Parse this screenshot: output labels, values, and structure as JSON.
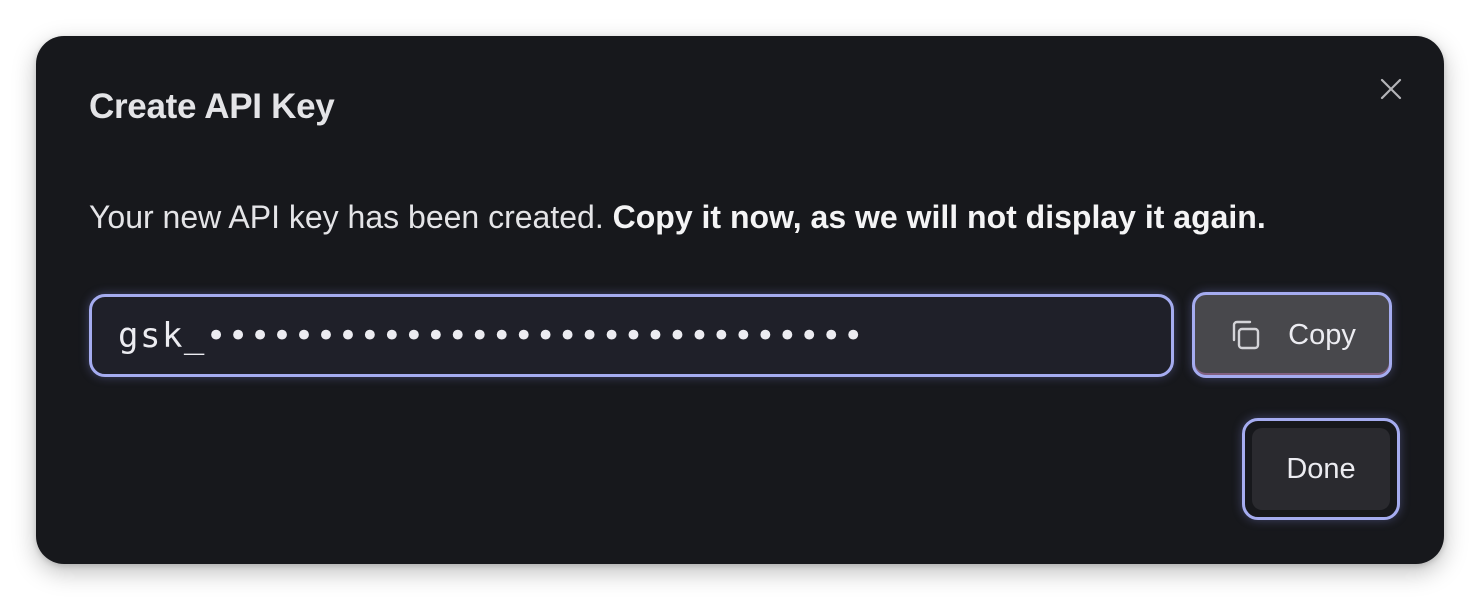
{
  "dialog": {
    "title": "Create API Key",
    "description_regular": "Your new API key has been created. ",
    "description_bold": "Copy it now, as we will not display it again.",
    "key_value": "gsk_••••••••••••••••••••••••••••••",
    "copy_label": "Copy",
    "done_label": "Done",
    "close_icon": "close-icon",
    "copy_icon": "copy-icon"
  },
  "colors": {
    "background": "#17181c",
    "focus_ring": "#a5acf0",
    "text": "#e4e4e7",
    "copy_button": "#48484c",
    "done_button": "#2a2a2f"
  }
}
